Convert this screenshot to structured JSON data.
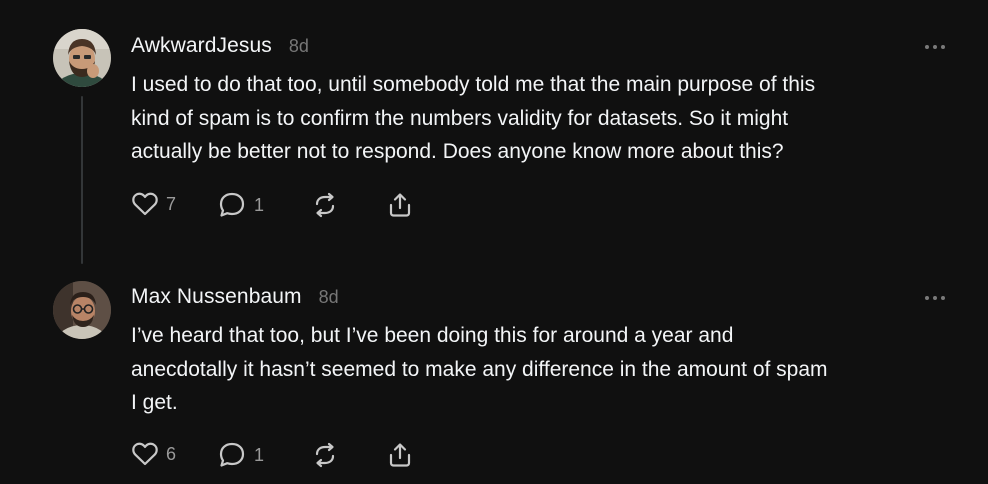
{
  "comments": [
    {
      "author": "AwkwardJesus",
      "time": "8d",
      "text": "I used to do that too, until somebody told me that the main purpose of this\nkind of spam is to confirm the numbers validity for datasets. So it might\nactually be better not to respond. Does anyone know more about this?",
      "likes": "7",
      "replies": "1"
    },
    {
      "author": "Max Nussenbaum",
      "time": "8d",
      "text": "I’ve heard that too, but I’ve been doing this for around a year and\nanecdotally it hasn’t seemed to make any difference in the amount of spam\nI get.",
      "likes": "6",
      "replies": "1"
    }
  ],
  "icons": {
    "like": "heart-icon",
    "reply": "comment-bubble-icon",
    "repost": "repost-icon",
    "share": "share-icon",
    "more": "more-options-icon"
  },
  "colors": {
    "background": "#101010",
    "text": "#f3f5f7",
    "muted": "#777777",
    "thread_line": "#333638"
  }
}
